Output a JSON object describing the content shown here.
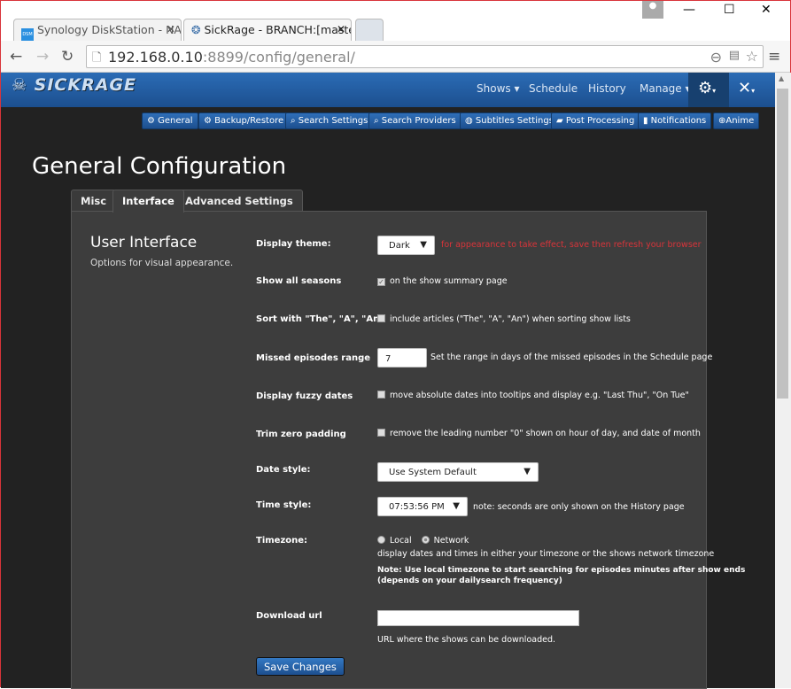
{
  "browser": {
    "tabs": [
      {
        "label": "Synology DiskStation - NA",
        "favicon": "dsm-icon"
      },
      {
        "label": "SickRage - BRANCH:[maste",
        "favicon": "sickrage-icon"
      }
    ],
    "url_host": "192.168.0.10",
    "url_port": ":8899",
    "url_path": "/config/general/"
  },
  "app": {
    "logo": "SICKRAGE",
    "nav": [
      {
        "label": "Shows ▾"
      },
      {
        "label": "Schedule"
      },
      {
        "label": "History"
      },
      {
        "label": "Manage ▾"
      }
    ],
    "accent": "#2b6cb5"
  },
  "subnav": [
    {
      "label": "⚙ General"
    },
    {
      "label": "⚙ Backup/Restore"
    },
    {
      "label": "⌕ Search Settings"
    },
    {
      "label": "⌕ Search Providers"
    },
    {
      "label": "◍ Subtitles Settings"
    },
    {
      "label": "▰ Post Processing"
    },
    {
      "label": "▮ Notifications"
    },
    {
      "label": "⊕Anime"
    }
  ],
  "page": {
    "title": "General Configuration",
    "tabs": [
      {
        "label": "Misc"
      },
      {
        "label": "Interface"
      },
      {
        "label": "Advanced Settings"
      }
    ],
    "section_title": "User Interface",
    "section_desc": "Options for visual appearance."
  },
  "form": {
    "theme": {
      "label": "Display theme:",
      "value": "Dark",
      "note": "for appearance to take effect, save then refresh your browser",
      "note_color": "#d9343a"
    },
    "all_seasons": {
      "label": "Show all seasons",
      "desc": "on the show summary page",
      "checked": true
    },
    "sort_articles": {
      "label": "Sort with \"The\", \"A\", \"An\"",
      "desc": "include articles (\"The\", \"A\", \"An\") when sorting show lists",
      "checked": false
    },
    "missed": {
      "label": "Missed episodes range",
      "value": "7",
      "desc": "Set the range in days of the missed episodes in the Schedule page"
    },
    "fuzzy": {
      "label": "Display fuzzy dates",
      "desc": "move absolute dates into tooltips and display e.g. \"Last Thu\", \"On Tue\"",
      "checked": false
    },
    "trim": {
      "label": "Trim zero padding",
      "desc": "remove the leading number \"0\" shown on hour of day, and date of month",
      "checked": false
    },
    "date_style": {
      "label": "Date style:",
      "value": "Use System Default"
    },
    "time_style": {
      "label": "Time style:",
      "value": "07:53:56 PM",
      "note": "note: seconds are only shown on the History page"
    },
    "timezone": {
      "label": "Timezone:",
      "options": [
        "Local",
        "Network"
      ],
      "selected": "Network",
      "desc": "display dates and times in either your timezone or the shows network timezone",
      "note1": "Note: Use local timezone to start searching for episodes minutes after show ends",
      "note2": "(depends on your dailysearch frequency)"
    },
    "download_url": {
      "label": "Download url",
      "value": "",
      "desc": "URL where the shows can be downloaded."
    },
    "save": "Save Changes"
  }
}
